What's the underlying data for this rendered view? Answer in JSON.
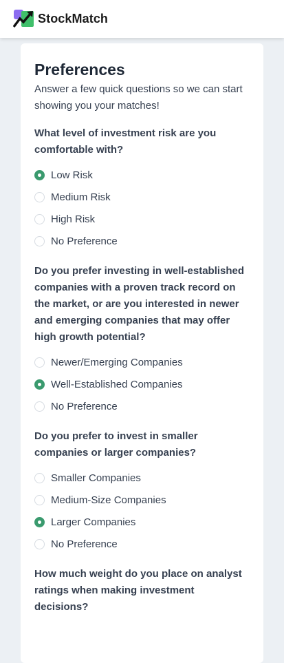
{
  "app": {
    "name": "StockMatch",
    "logo_icon": "stock-growth-arrow-icon",
    "accent_color": "#3a9a6e"
  },
  "preferences": {
    "title": "Preferences",
    "subtitle": "Answer a few quick questions so we can start showing you your matches!",
    "questions": [
      {
        "text": "What level of investment risk are you comfortable with?",
        "options": [
          {
            "label": "Low Risk",
            "selected": true
          },
          {
            "label": "Medium Risk",
            "selected": false
          },
          {
            "label": "High Risk",
            "selected": false
          },
          {
            "label": "No Preference",
            "selected": false
          }
        ]
      },
      {
        "text": "Do you prefer investing in well-established companies with a proven track record on the market, or are you interested in newer and emerging companies that may offer high growth potential?",
        "options": [
          {
            "label": "Newer/Emerging Companies",
            "selected": false
          },
          {
            "label": "Well-Established Companies",
            "selected": true
          },
          {
            "label": "No Preference",
            "selected": false
          }
        ]
      },
      {
        "text": "Do you prefer to invest in smaller companies or larger companies?",
        "options": [
          {
            "label": "Smaller Companies",
            "selected": false
          },
          {
            "label": "Medium-Size Companies",
            "selected": false
          },
          {
            "label": "Larger Companies",
            "selected": true
          },
          {
            "label": "No Preference",
            "selected": false
          }
        ]
      },
      {
        "text": "How much weight do you place on analyst ratings when making investment decisions?",
        "options": []
      }
    ]
  }
}
